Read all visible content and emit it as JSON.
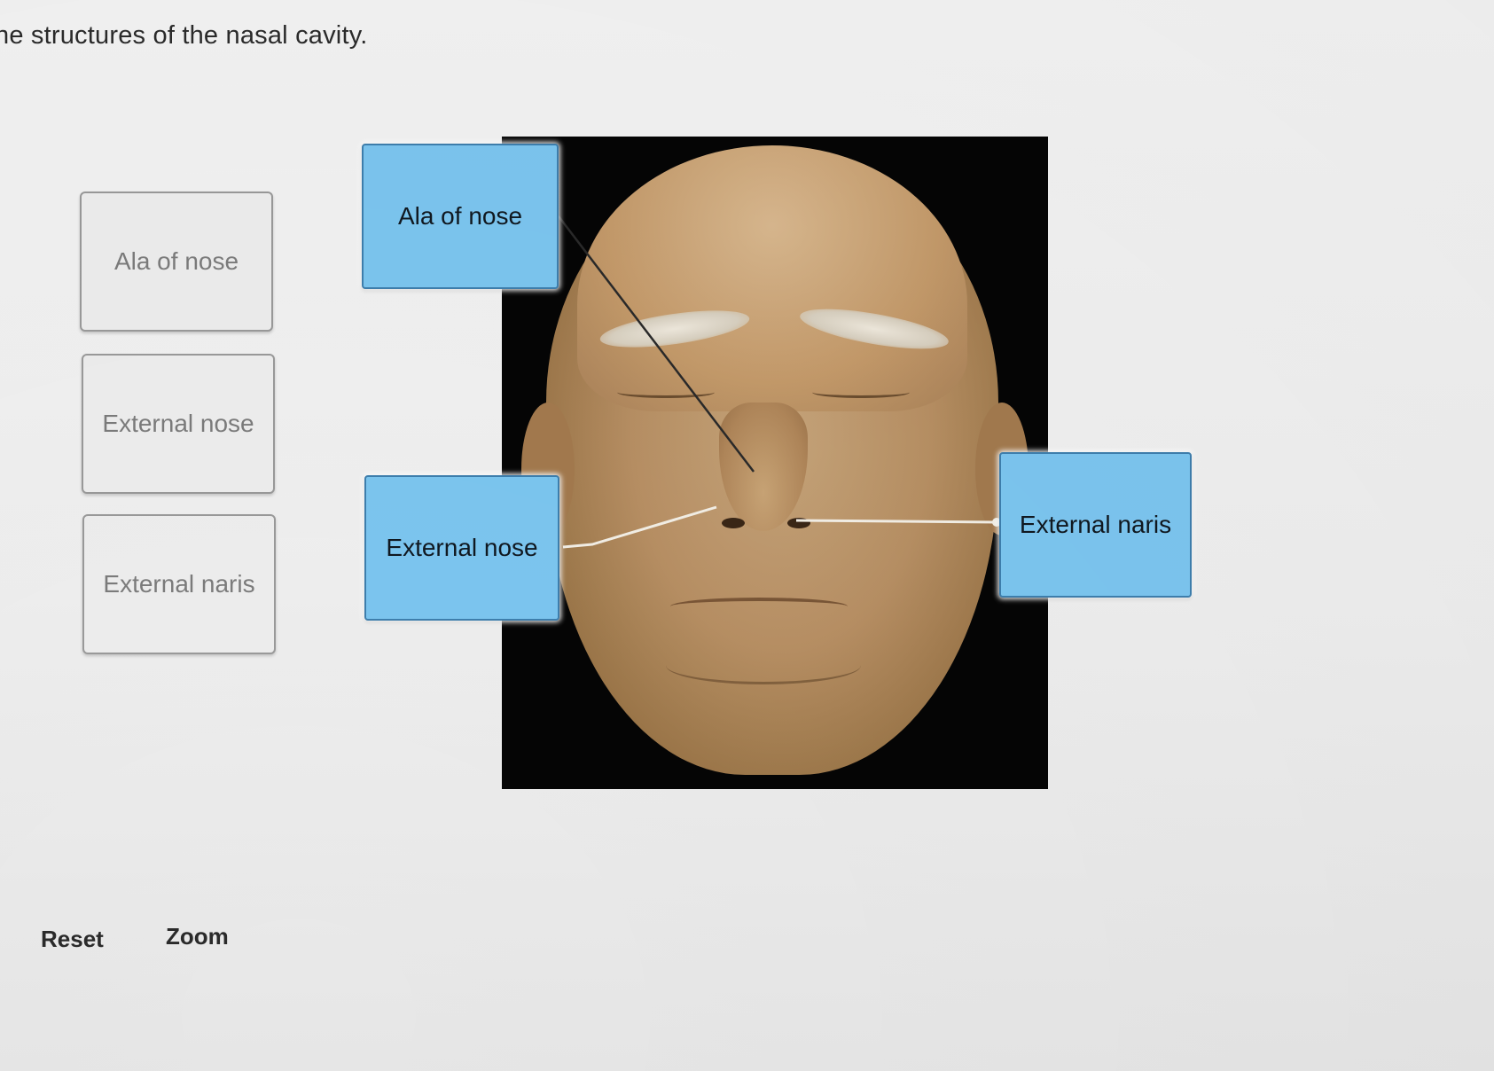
{
  "instruction": "he structures of the nasal cavity.",
  "label_bank": {
    "items": [
      {
        "label": "Ala of nose"
      },
      {
        "label": "External nose"
      },
      {
        "label": "External naris"
      }
    ]
  },
  "figure": {
    "placed_labels": [
      {
        "label": "Ala of nose"
      },
      {
        "label": "External nose"
      },
      {
        "label": "External naris"
      }
    ]
  },
  "actions": {
    "reset_label": "Reset",
    "zoom_label": "Zoom"
  },
  "colors": {
    "label_fill": "#7cc6f0",
    "label_border": "#3e7fae",
    "bank_tile_text": "#7c7c7c"
  }
}
